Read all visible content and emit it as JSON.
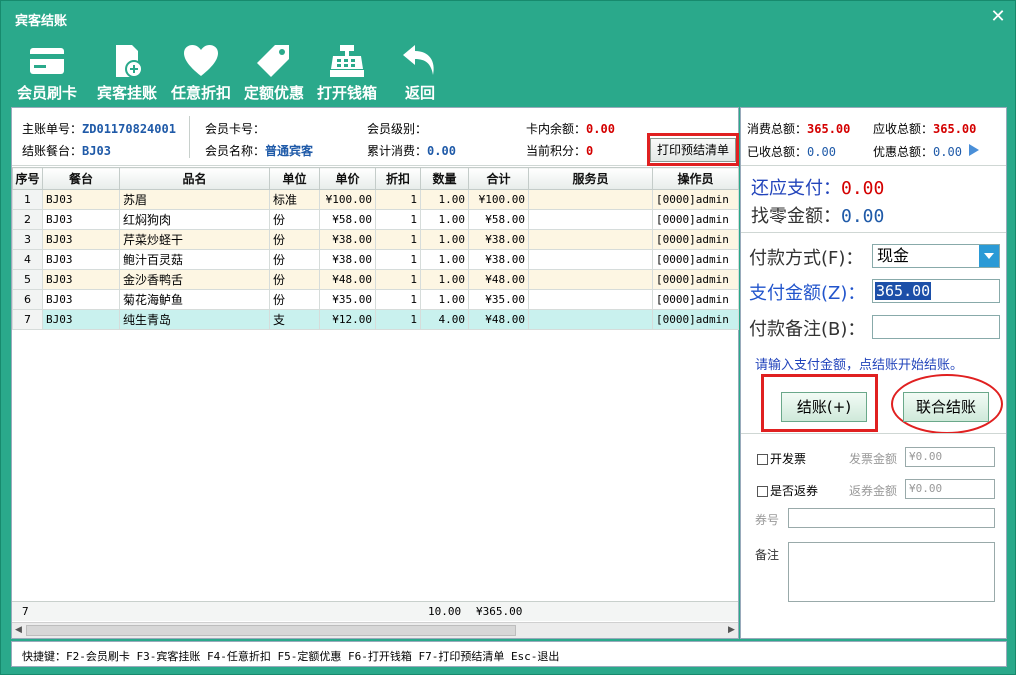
{
  "window": {
    "title": "宾客结账"
  },
  "toolbar": [
    {
      "label": "会员刷卡",
      "icon": "card-icon"
    },
    {
      "label": "宾客挂账",
      "icon": "add-document-icon"
    },
    {
      "label": "任意折扣",
      "icon": "heart-icon"
    },
    {
      "label": "定额优惠",
      "icon": "tag-icon"
    },
    {
      "label": "打开钱箱",
      "icon": "cash-register-icon"
    },
    {
      "label": "返回",
      "icon": "return-arrow-icon"
    }
  ],
  "info": {
    "main_bill_label": "主账单号：",
    "main_bill_value": "ZD01170824001",
    "table_label": "结账餐台：",
    "table_value": "BJ03",
    "member_card_label": "会员卡号：",
    "member_card_value": "",
    "member_name_label": "会员名称：",
    "member_name_value": "普通宾客",
    "member_level_label": "会员级别：",
    "member_level_value": "",
    "total_consume_label": "累计消费：",
    "total_consume_value": "0.00",
    "card_balance_label": "卡内余额：",
    "card_balance_value": "0.00",
    "points_label": "当前积分：",
    "points_value": "0",
    "print_button": "打印预结清单"
  },
  "grid": {
    "columns": [
      "序号",
      "餐台",
      "品名",
      "单位",
      "单价",
      "折扣",
      "数量",
      "合计",
      "服务员",
      "操作员"
    ],
    "rows": [
      {
        "idx": "1",
        "table": "BJ03",
        "name": "苏眉",
        "unit": "标准",
        "price": "¥100.00",
        "discount": "1",
        "qty": "1.00",
        "total": "¥100.00",
        "waiter": "",
        "operator": "[0000]admin"
      },
      {
        "idx": "2",
        "table": "BJ03",
        "name": "红焖狗肉",
        "unit": "份",
        "price": "¥58.00",
        "discount": "1",
        "qty": "1.00",
        "total": "¥58.00",
        "waiter": "",
        "operator": "[0000]admin"
      },
      {
        "idx": "3",
        "table": "BJ03",
        "name": "芹菜炒蛏干",
        "unit": "份",
        "price": "¥38.00",
        "discount": "1",
        "qty": "1.00",
        "total": "¥38.00",
        "waiter": "",
        "operator": "[0000]admin"
      },
      {
        "idx": "4",
        "table": "BJ03",
        "name": "鲍汁百灵菇",
        "unit": "份",
        "price": "¥38.00",
        "discount": "1",
        "qty": "1.00",
        "total": "¥38.00",
        "waiter": "",
        "operator": "[0000]admin"
      },
      {
        "idx": "5",
        "table": "BJ03",
        "name": "金沙香鸭舌",
        "unit": "份",
        "price": "¥48.00",
        "discount": "1",
        "qty": "1.00",
        "total": "¥48.00",
        "waiter": "",
        "operator": "[0000]admin"
      },
      {
        "idx": "6",
        "table": "BJ03",
        "name": "菊花海鲈鱼",
        "unit": "份",
        "price": "¥35.00",
        "discount": "1",
        "qty": "1.00",
        "total": "¥35.00",
        "waiter": "",
        "operator": "[0000]admin"
      },
      {
        "idx": "7",
        "table": "BJ03",
        "name": "纯生青岛",
        "unit": "支",
        "price": "¥12.00",
        "discount": "1",
        "qty": "4.00",
        "total": "¥48.00",
        "waiter": "",
        "operator": "[0000]admin"
      }
    ],
    "footer": {
      "count": "7",
      "qty_sum": "10.00",
      "total_sum": "¥365.00"
    }
  },
  "summary": {
    "consume_total_label": "消费总额：",
    "consume_total_value": "365.00",
    "receivable_label": "应收总额：",
    "receivable_value": "365.00",
    "received_label": "已收总额：",
    "received_value": "0.00",
    "discount_total_label": "优惠总额：",
    "discount_total_value": "0.00"
  },
  "payment": {
    "due_label": "还应支付：",
    "due_value": "0.00",
    "change_label": "找零金额：",
    "change_value": "0.00",
    "method_label": "付款方式(F)：",
    "method_value": "现金",
    "amount_label": "支付金额(Z)：",
    "amount_value": "365.00",
    "note_label": "付款备注(B)：",
    "note_value": "",
    "hint": "请输入支付金额，点结账开始结账。",
    "checkout_button": "结账(+)",
    "joint_checkout_button": "联合结账"
  },
  "invoice": {
    "invoice_check": "开发票",
    "invoice_amount_label": "发票金额",
    "invoice_amount_value": "¥0.00",
    "coupon_check": "是否返券",
    "coupon_amount_label": "返券金额",
    "coupon_amount_value": "¥0.00",
    "coupon_no_label": "券号",
    "coupon_no_value": "",
    "remark_label": "备注",
    "remark_value": ""
  },
  "statusbar": {
    "text": "快捷键：F2-会员刷卡  F3-宾客挂账 F4-任意折扣 F5-定额优惠 F6-打开钱箱 F7-打印预结清单 Esc-退出"
  }
}
